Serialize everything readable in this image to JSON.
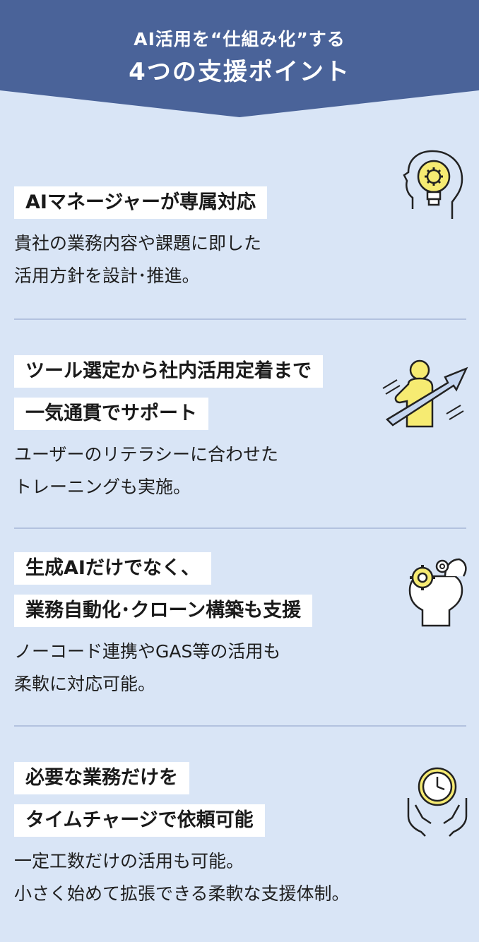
{
  "header": {
    "line1": "AI活用を“仕組み化”する",
    "line2": "4つの支援ポイント",
    "color": "#4a6399"
  },
  "points": [
    {
      "labels": [
        "AIマネージャーが専属対応"
      ],
      "desc": [
        "貴社の業務内容や課題に即した",
        "活用方針を設計･推進。"
      ],
      "icon": "lightbulb-head-icon"
    },
    {
      "labels": [
        "ツール選定から社内活用定着まで",
        "一気通貫でサポート"
      ],
      "desc": [
        "ユーザーのリテラシーに合わせた",
        "トレーニングも実施。"
      ],
      "icon": "person-arrow-growth-icon"
    },
    {
      "labels": [
        "生成AIだけでなく、",
        "業務自動化･クローン構築も支援"
      ],
      "desc": [
        "ノーコード連携やGAS等の活用も",
        "柔軟に対応可能。"
      ],
      "icon": "gears-head-icon"
    },
    {
      "labels": [
        "必要な業務だけを",
        "タイムチャージで依頼可能"
      ],
      "desc": [
        "一定工数だけの活用も可能。",
        "小さく始めて拡張できる柔軟な支援体制。"
      ],
      "icon": "clock-hands-icon"
    }
  ],
  "colors": {
    "background": "#d9e5f6",
    "accent_yellow": "#f6eb72",
    "divider": "#b3c2df",
    "arrow_blue": "#c5d6f0"
  }
}
